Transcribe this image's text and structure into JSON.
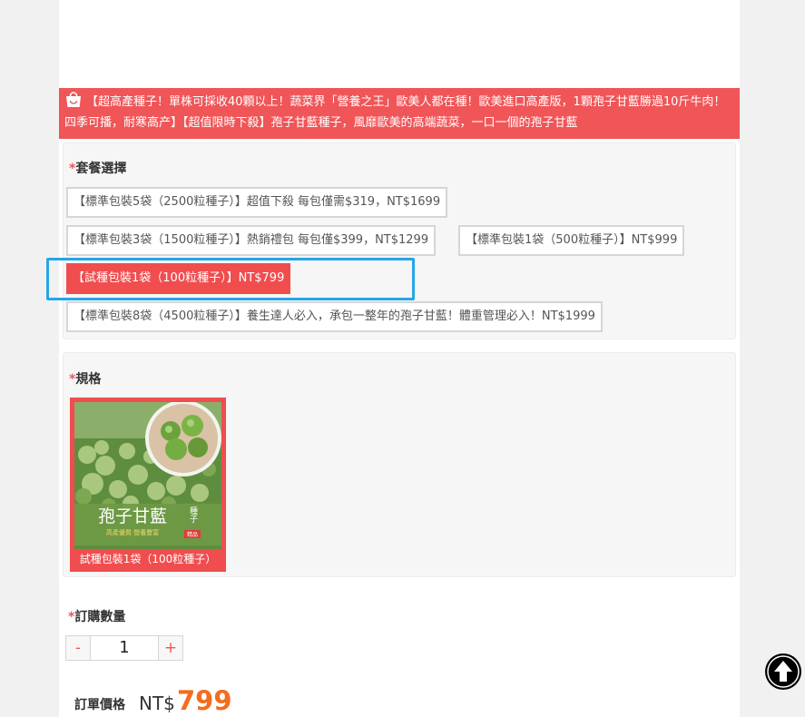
{
  "product": {
    "title": "【超高產種子！單株可採收40顆以上！蔬菜界「營養之王」歐美人都在種！歐美進口高產版，1顆孢子甘藍勝過10斤牛肉！四季可播，耐寒高产】【超值限時下殺】孢子甘藍種子，風靡歐美的高端蔬菜，一口一個的孢子甘藍"
  },
  "package": {
    "required_mark": "*",
    "label": "套餐選擇",
    "options": [
      {
        "label": "【標準包裝5袋（2500粒種子）】超值下殺 每包僅需$319，NT$1699"
      },
      {
        "label": "【標準包裝3袋（1500粒種子）】熱銷禮包 每包僅$399，NT$1299"
      },
      {
        "label": "【標準包裝1袋（500粒種子）】NT$999"
      },
      {
        "label": "【試種包裝1袋（100粒種子）】NT$799",
        "selected": true
      },
      {
        "label": "【標準包裝8袋（4500粒種子）】養生達人必入，承包一整年的孢子甘藍！體重管理必入！NT$1999"
      }
    ]
  },
  "spec": {
    "required_mark": "*",
    "label": "規格",
    "item": {
      "caption": "試種包裝1袋（100粒種子）",
      "image_text": {
        "name": "孢子甘藍",
        "side": "種子",
        "sub": "高產優質·營養豐富",
        "badge": "精品"
      }
    }
  },
  "quantity": {
    "required_mark": "*",
    "label": "訂購數量",
    "minus": "-",
    "plus": "+",
    "value": "1"
  },
  "price": {
    "label": "訂單價格",
    "currency": "NT$",
    "amount": "799"
  },
  "colors": {
    "accent": "#f05558",
    "selected": "#f04d4f",
    "price": "#f46c1e",
    "focus": "#26a6e6"
  },
  "icons": [
    "shopping-bag-icon",
    "back-to-top-icon"
  ]
}
